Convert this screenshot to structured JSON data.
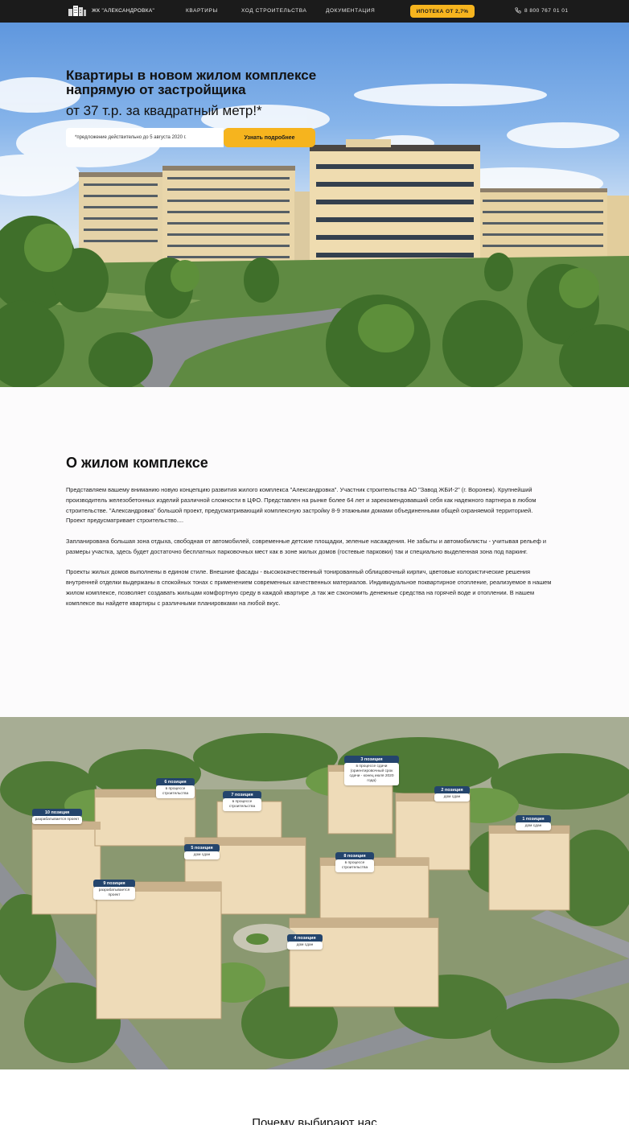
{
  "nav": {
    "logo_text": "ЖК \"АЛЕКСАНДРОВКА\"",
    "links": [
      "КВАРТИРЫ",
      "ХОД СТРОИТЕЛЬСТВА",
      "ДОКУМЕНТАЦИЯ"
    ],
    "cta": "ИПОТЕКА ОТ 2,7%",
    "phone": "8 800 767 01 01",
    "colors": {
      "bar": "#1b1b1b",
      "accent": "#f6b41e"
    }
  },
  "hero": {
    "title": "Квартиры в новом жилом комплексе напрямую от застройщика",
    "subtitle": "от 37 т.р. за квадратный метр!*",
    "note": "*предложение действительно до 5 августа 2020 г.",
    "button": "Узнать подробнее"
  },
  "about": {
    "title": "О жилом комплексе",
    "paragraphs": [
      "Представляем вашему вниманию новую концепцию развития жилого комплекса \"Александровка\". Участник строительства АО \"Завод ЖБИ-2\" (г. Воронеж). Крупнейший производитель железобетонных изделий различной сложности в ЦФО. Представлен на рынке более 64 лет и зарекомендовавший себя как надежного партнера в любом строительстве. \"Александровка\" большой проект, предусматривающий комплексную застройку 8-9 этажными домами объединенными общей охраняемой территорией. Проект предусматривает строительство....",
      "Запланирована большая зона отдыха, свободная от автомобилей, современные детские площадки, зеленые насаждения. Не забыты и автомобилисты - учитывая рельеф и размеры участка, здесь будет достаточно бесплатных парковочных мест как в зоне жилых домов (гостевые парковки) так и специально выделенная зона под паркинг.",
      "Проекты жилых домов выполнены в едином стиле. Внешние фасады - высококачественный тонированный облицовочный кирпич, цветовые колористические решения внутренней отделки выдержаны в спокойных тонах с применением современных качественных материалов. Индивидуальное поквартирное отопление, реализуемое в нашем жилом комплексе, позволяет создавать жильцам комфортную среду в каждой квартире ,а так же сэкономить денежные средства на горячей воде и отоплении. В нашем комплексе вы найдете квартиры с различными планировками на любой вкус."
    ]
  },
  "positions": [
    {
      "head": "10 позиция",
      "status": "разрабатывается проект"
    },
    {
      "head": "6 позиция",
      "status": "в процессе строительства"
    },
    {
      "head": "7 позиция",
      "status": "в процессе строительства"
    },
    {
      "head": "3 позиция",
      "status": "в процессе сдачи (ориентировочный срок сдачи - конец июля 2020 года)"
    },
    {
      "head": "2 позиция",
      "status": "дом сдан"
    },
    {
      "head": "1 позиция",
      "status": "дом сдан"
    },
    {
      "head": "5 позиция",
      "status": "дом сдан"
    },
    {
      "head": "8 позиция",
      "status": "в процессе строительства"
    },
    {
      "head": "9 позиция",
      "status": "разрабатывается проект"
    },
    {
      "head": "4 позиция",
      "status": "дом сдан"
    }
  ],
  "next": {
    "title": "Почему выбирают нас"
  }
}
